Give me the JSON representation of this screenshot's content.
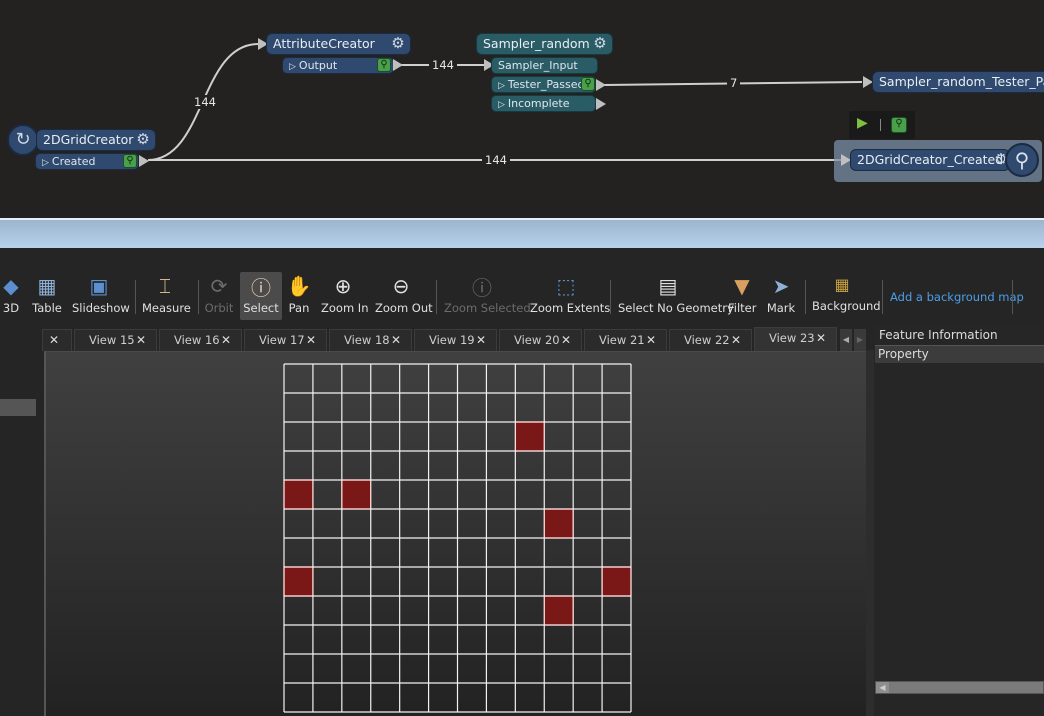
{
  "workspace": {
    "nodes": [
      {
        "name": "2DGridCreator",
        "ports": [
          {
            "label": "Created",
            "type": "output"
          }
        ],
        "color": "#2f4a6e"
      },
      {
        "name": "AttributeCreator",
        "ports": [
          {
            "label": "Output",
            "type": "output"
          }
        ],
        "color": "#2f4a6e"
      },
      {
        "name": "Sampler_random",
        "ports": [
          {
            "label": "Sampler_Input",
            "type": "input"
          },
          {
            "label": "Tester_Passed",
            "type": "output"
          },
          {
            "label": "Incomplete",
            "type": "output"
          }
        ],
        "color": "#2a5c66"
      },
      {
        "name": "Sampler_random_Tester_Pass",
        "ports": [],
        "color": "#2f4a6e"
      },
      {
        "name": "2DGridCreator_Created",
        "ports": [],
        "color": "#2f4a6e"
      }
    ],
    "connections": [
      {
        "from": "2DGridCreator.Created",
        "to": "AttributeCreator",
        "count": "144"
      },
      {
        "from": "AttributeCreator.Output",
        "to": "Sampler_random.Sampler_Input",
        "count": "144"
      },
      {
        "from": "Sampler_random.Tester_Passed",
        "to": "Sampler_random_Tester_Pass",
        "count": "7"
      },
      {
        "from": "2DGridCreator.Created",
        "to": "2DGridCreator_Created",
        "count": "144"
      }
    ]
  },
  "toolbar": {
    "items": [
      {
        "label": "3D",
        "icon": "3d-shapes-icon",
        "enabled": true
      },
      {
        "label": "Table",
        "icon": "table-icon",
        "enabled": true
      },
      {
        "label": "Slideshow",
        "icon": "slideshow-icon",
        "enabled": true
      },
      {
        "label": "Measure",
        "icon": "measure-icon",
        "enabled": true
      },
      {
        "label": "Orbit",
        "icon": "orbit-icon",
        "enabled": false
      },
      {
        "label": "Select",
        "icon": "select-info-icon",
        "enabled": true,
        "active": true
      },
      {
        "label": "Pan",
        "icon": "hand-icon",
        "enabled": true
      },
      {
        "label": "Zoom In",
        "icon": "zoom-in-icon",
        "enabled": true
      },
      {
        "label": "Zoom Out",
        "icon": "zoom-out-icon",
        "enabled": true
      },
      {
        "label": "Zoom Selected",
        "icon": "zoom-selected-icon",
        "enabled": false
      },
      {
        "label": "Zoom Extents",
        "icon": "zoom-extents-icon",
        "enabled": true
      },
      {
        "label": "Select No Geometry",
        "icon": "select-no-geometry-icon",
        "enabled": true
      },
      {
        "label": "Filter",
        "icon": "filter-icon",
        "enabled": true
      },
      {
        "label": "Mark",
        "icon": "mark-icon",
        "enabled": true
      },
      {
        "label": "Background",
        "icon": "background-icon",
        "enabled": true
      }
    ],
    "background_map_link": "Add a background map"
  },
  "tabs": [
    "View 15",
    "View 16",
    "View 17",
    "View 18",
    "View 19",
    "View 20",
    "View 21",
    "View 22",
    "View 23"
  ],
  "active_tab": "View 23",
  "viewport": {
    "grid_rows": 12,
    "grid_cols": 12,
    "highlight_color": "#7a1818",
    "selected_cells": [
      [
        2,
        8
      ],
      [
        4,
        0
      ],
      [
        4,
        2
      ],
      [
        5,
        9
      ],
      [
        7,
        0
      ],
      [
        7,
        11
      ],
      [
        8,
        9
      ]
    ]
  },
  "feature_info": {
    "title": "Feature Information",
    "column_header": "Property"
  },
  "glyphs": {
    "gear": "⚙",
    "close": "✕",
    "tri": "▷",
    "search": "⚲",
    "left": "◀",
    "right": "▶",
    "float": "🗗"
  }
}
